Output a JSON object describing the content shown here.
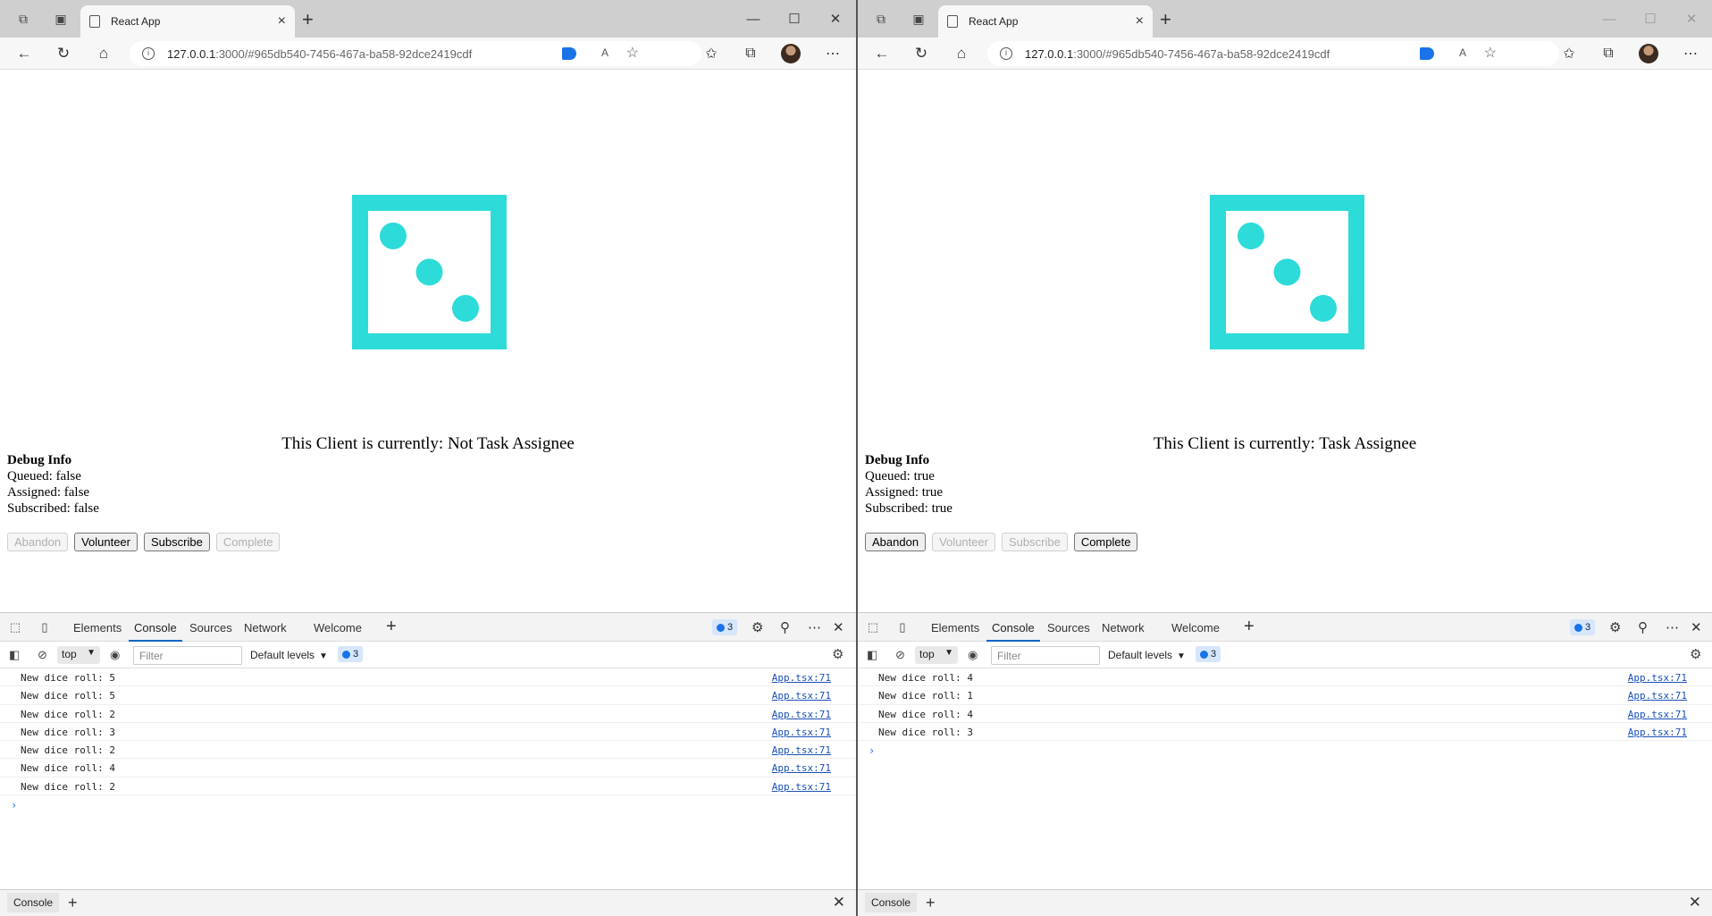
{
  "browser": {
    "tab_title": "React App",
    "url_host": "127.0.0.1",
    "url_rest": ":3000/#965db540-7456-467a-ba58-92dce2419cdf",
    "read_aloud": "A",
    "win_minimize": "—",
    "win_maximize": "☐",
    "win_close": "✕"
  },
  "colors": {
    "dice": "#2ddbd9",
    "accent": "#0a64c8"
  },
  "app": {
    "debug_heading": "Debug Info",
    "buttons": {
      "abandon": "Abandon",
      "volunteer": "Volunteer",
      "subscribe": "Subscribe",
      "complete": "Complete"
    }
  },
  "devtools": {
    "tabs": [
      "Elements",
      "Console",
      "Sources",
      "Network",
      "Welcome"
    ],
    "issues_count": "3",
    "context": "top",
    "filter_placeholder": "Filter",
    "levels": "Default levels",
    "drawer_tab": "Console"
  },
  "left": {
    "status": "This Client is currently: Not Task Assignee",
    "queued": "Queued: false",
    "assigned": "Assigned: false",
    "subscribed": "Subscribed: false",
    "logs": [
      {
        "msg": "New dice roll: 5",
        "src": "App.tsx:71"
      },
      {
        "msg": "New dice roll: 5",
        "src": "App.tsx:71"
      },
      {
        "msg": "New dice roll: 2",
        "src": "App.tsx:71"
      },
      {
        "msg": "New dice roll: 3",
        "src": "App.tsx:71"
      },
      {
        "msg": "New dice roll: 2",
        "src": "App.tsx:71"
      },
      {
        "msg": "New dice roll: 4",
        "src": "App.tsx:71"
      },
      {
        "msg": "New dice roll: 2",
        "src": "App.tsx:71"
      }
    ]
  },
  "right": {
    "status": "This Client is currently: Task Assignee",
    "queued": "Queued: true",
    "assigned": "Assigned: true",
    "subscribed": "Subscribed: true",
    "logs": [
      {
        "msg": "New dice roll: 4",
        "src": "App.tsx:71"
      },
      {
        "msg": "New dice roll: 1",
        "src": "App.tsx:71"
      },
      {
        "msg": "New dice roll: 4",
        "src": "App.tsx:71"
      },
      {
        "msg": "New dice roll: 3",
        "src": "App.tsx:71"
      }
    ]
  }
}
